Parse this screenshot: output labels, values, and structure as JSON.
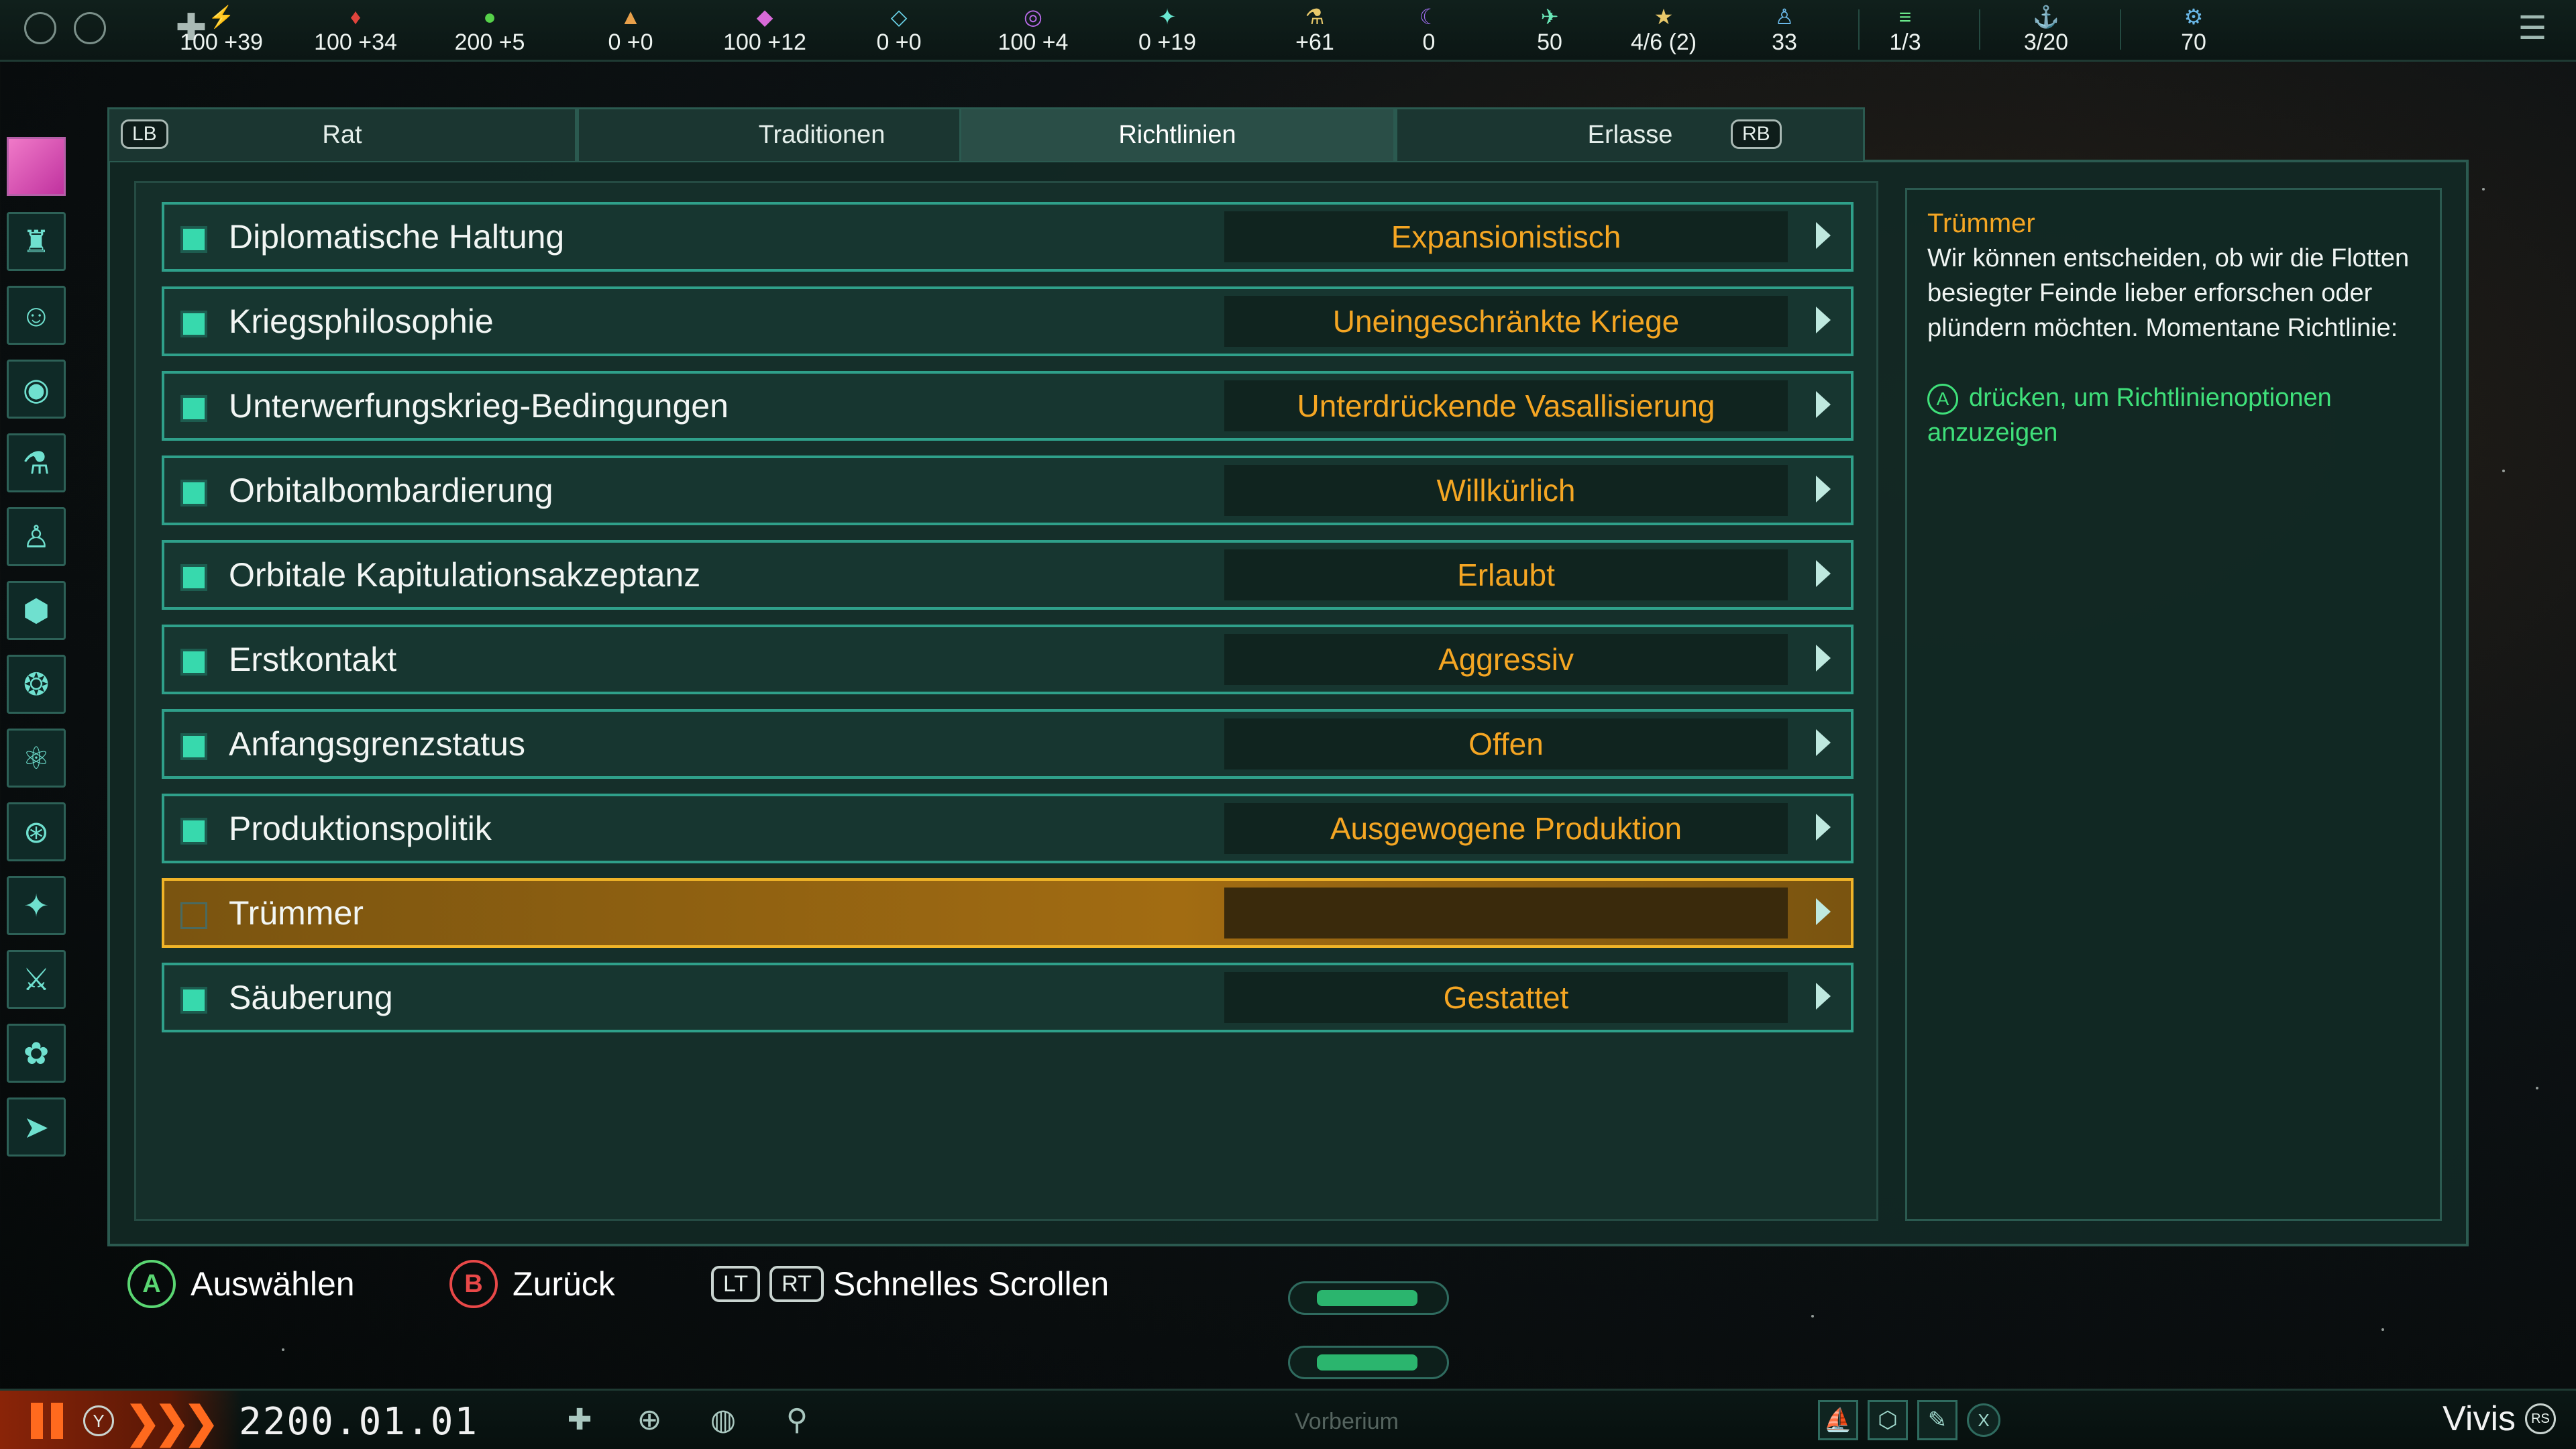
{
  "topbar": {
    "resources": [
      {
        "icon": "⚡",
        "value": "100 +39",
        "color": "#f6d24a",
        "name": "energy"
      },
      {
        "icon": "♦",
        "value": "100 +34",
        "color": "#e0443c",
        "name": "minerals"
      },
      {
        "icon": "●",
        "value": "200 +5",
        "color": "#56d14a",
        "name": "food"
      },
      {
        "icon": "▲",
        "value": "0 +0",
        "color": "#e8a04a",
        "name": "consumer-goods"
      },
      {
        "icon": "◆",
        "value": "100 +12",
        "color": "#d86ad8",
        "name": "alloys"
      },
      {
        "icon": "◇",
        "value": "0 +0",
        "color": "#6ad2e8",
        "name": "strategic"
      },
      {
        "icon": "◎",
        "value": "100 +4",
        "color": "#b86ae8",
        "name": "influence"
      },
      {
        "icon": "✦",
        "value": "0 +19",
        "color": "#6ae8d2",
        "name": "unity"
      },
      {
        "icon": "⚗",
        "value": "+61",
        "color": "#e8c86a",
        "name": "research"
      },
      {
        "icon": "☾",
        "value": "0",
        "color": "#9a6ae8",
        "name": "amenities"
      },
      {
        "icon": "✈",
        "value": "50",
        "color": "#6ae8b8",
        "name": "naval"
      },
      {
        "icon": "★",
        "value": "4/6 (2)",
        "color": "#e8c86a",
        "name": "leaders"
      },
      {
        "icon": "♙",
        "value": "33",
        "color": "#6ab8e8",
        "name": "pops"
      },
      {
        "icon": "≡",
        "value": "1/3",
        "color": "#6ae88a",
        "name": "starbases"
      },
      {
        "icon": "⚓",
        "value": "3/20",
        "color": "#6ab8e8",
        "name": "fleets"
      },
      {
        "icon": "⚙",
        "value": "70",
        "color": "#6ab8e8",
        "name": "admin"
      }
    ]
  },
  "tabs": {
    "lb": "LB",
    "rb": "RB",
    "items": [
      {
        "label": "Rat"
      },
      {
        "label": "Traditionen"
      },
      {
        "label": "Richtlinien"
      },
      {
        "label": "Erlasse"
      }
    ],
    "active_index": 2
  },
  "policies": [
    {
      "label": "Diplomatische Haltung",
      "value": "Expansionistisch",
      "checked": true
    },
    {
      "label": "Kriegsphilosophie",
      "value": "Uneingeschränkte Kriege",
      "checked": true
    },
    {
      "label": "Unterwerfungskrieg-Bedingungen",
      "value": "Unterdrückende Vasallisierung",
      "checked": true
    },
    {
      "label": "Orbitalbombardierung",
      "value": "Willkürlich",
      "checked": true
    },
    {
      "label": "Orbitale Kapitulationsakzeptanz",
      "value": "Erlaubt",
      "checked": true
    },
    {
      "label": "Erstkontakt",
      "value": "Aggressiv",
      "checked": true
    },
    {
      "label": "Anfangsgrenzstatus",
      "value": "Offen",
      "checked": true
    },
    {
      "label": "Produktionspolitik",
      "value": "Ausgewogene Produktion",
      "checked": true
    },
    {
      "label": "Trümmer",
      "value": "",
      "checked": false,
      "selected": true
    },
    {
      "label": "Säuberung",
      "value": "Gestattet",
      "checked": true
    }
  ],
  "info": {
    "title": "Trümmer",
    "body": "Wir können entscheiden, ob wir die Flotten besiegter Feinde lieber erforschen oder plündern möchten. Momentane Richtlinie:",
    "hint_button": "A",
    "hint_text": "drücken, um Richtlinienoptionen anzuzeigen"
  },
  "hints": {
    "select_button": "A",
    "select_label": "Auswählen",
    "back_button": "B",
    "back_label": "Zurück",
    "lt": "LT",
    "rt": "RT",
    "scroll_label": "Schnelles Scrollen"
  },
  "bottombar": {
    "y_button": "Y",
    "speed": "❯❯❯",
    "date": "2200.01.01",
    "location": "Vivis",
    "rs_button": "RS",
    "x_button": "X",
    "map_label": "Vorberium"
  },
  "colors": {
    "accent_teal": "#2fa08a",
    "value_orange": "#f5a623",
    "hint_green": "#3fe07a",
    "selected_gold": "#f0b428"
  }
}
